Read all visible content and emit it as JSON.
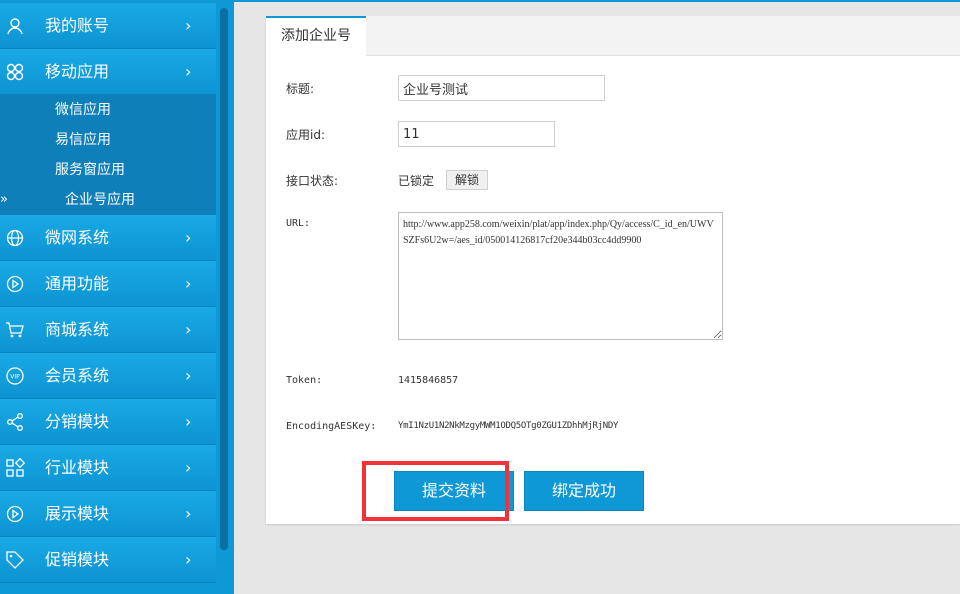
{
  "sidebar": {
    "items": [
      {
        "id": "account",
        "label": "我的账号",
        "icon": "user-icon"
      },
      {
        "id": "mobile-apps",
        "label": "移动应用",
        "icon": "clover-icon"
      },
      {
        "id": "micro-site",
        "label": "微网系统",
        "icon": "globe-icon"
      },
      {
        "id": "general",
        "label": "通用功能",
        "icon": "play-circle-icon"
      },
      {
        "id": "mall",
        "label": "商城系统",
        "icon": "cart-icon"
      },
      {
        "id": "members",
        "label": "会员系统",
        "icon": "vip-icon"
      },
      {
        "id": "distribution",
        "label": "分销模块",
        "icon": "share-icon"
      },
      {
        "id": "industry",
        "label": "行业模块",
        "icon": "grid-icon"
      },
      {
        "id": "display",
        "label": "展示模块",
        "icon": "play-circle-icon"
      },
      {
        "id": "promotion",
        "label": "促销模块",
        "icon": "tag-icon"
      }
    ],
    "chevron": "›",
    "submenu": [
      {
        "label": "微信应用"
      },
      {
        "label": "易信应用"
      },
      {
        "label": "服务窗应用"
      },
      {
        "label": "企业号应用",
        "active": true
      }
    ],
    "active_marker": "»"
  },
  "tab": {
    "label": "添加企业号"
  },
  "form": {
    "title_label": "标题:",
    "title_value": "企业号测试",
    "appid_label": "应用id:",
    "appid_value": "11",
    "status_label": "接口状态:",
    "status_value": "已锁定",
    "unlock_label": "解锁",
    "url_label": "URL:",
    "url_value": "http://www.app258.com/weixin/plat/app/index.php/Qy/access/C_id_en/UWVSZFs6U2w=/aes_id/050014126817cf20e344b03cc4dd9900",
    "token_label": "Token:",
    "token_value": "1415846857",
    "aes_label": "EncodingAESKey:",
    "aes_value": "YmI1NzU1N2NkMzgyMWM1ODQ5OTg0ZGU1ZDhhMjRjNDY"
  },
  "buttons": {
    "submit_label": "提交资料",
    "bind_label": "绑定成功"
  },
  "colors": {
    "accent": "#0f98d6",
    "highlight": "#f0323a"
  }
}
